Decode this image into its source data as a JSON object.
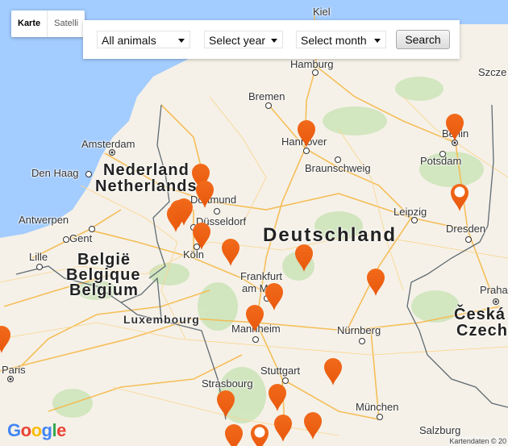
{
  "map_type_control": {
    "options": [
      {
        "label": "Karte",
        "active": true
      },
      {
        "label": "Satelli",
        "active": false
      }
    ]
  },
  "filters": {
    "animal": {
      "selected": "All animals"
    },
    "year": {
      "selected": "Select year"
    },
    "month": {
      "selected": "Select month"
    },
    "search_label": "Search"
  },
  "map": {
    "countries": [
      {
        "name": "Deutschland"
      },
      {
        "name": "Nederland"
      },
      {
        "name": "Netherlands"
      },
      {
        "name": "België"
      },
      {
        "name": "Belgique"
      },
      {
        "name": "Belgium"
      },
      {
        "name": "Luxembourg"
      },
      {
        "name": "Česká"
      },
      {
        "name": "Czech"
      }
    ],
    "cities": [
      "Kiel",
      "Hamburg",
      "Szcze",
      "Bremen",
      "Hannover",
      "Braunschweig",
      "Berlin",
      "Potsdam",
      "Amsterdam",
      "Den Haag",
      "Dortmund",
      "Leipzig",
      "Dresden",
      "Antwerpen",
      "Gent",
      "Düsseldorf",
      "Lille",
      "Köln",
      "Frankfurt",
      "am Main",
      "Praha",
      "Mannheim",
      "Nürnberg",
      "Paris",
      "Stuttgart",
      "Strasbourg",
      "München",
      "Salzburg"
    ],
    "marker_color": "#e8580c",
    "marker_count": 22
  },
  "footer": {
    "logo": "Google",
    "attribution": "Kartendaten © 20"
  }
}
